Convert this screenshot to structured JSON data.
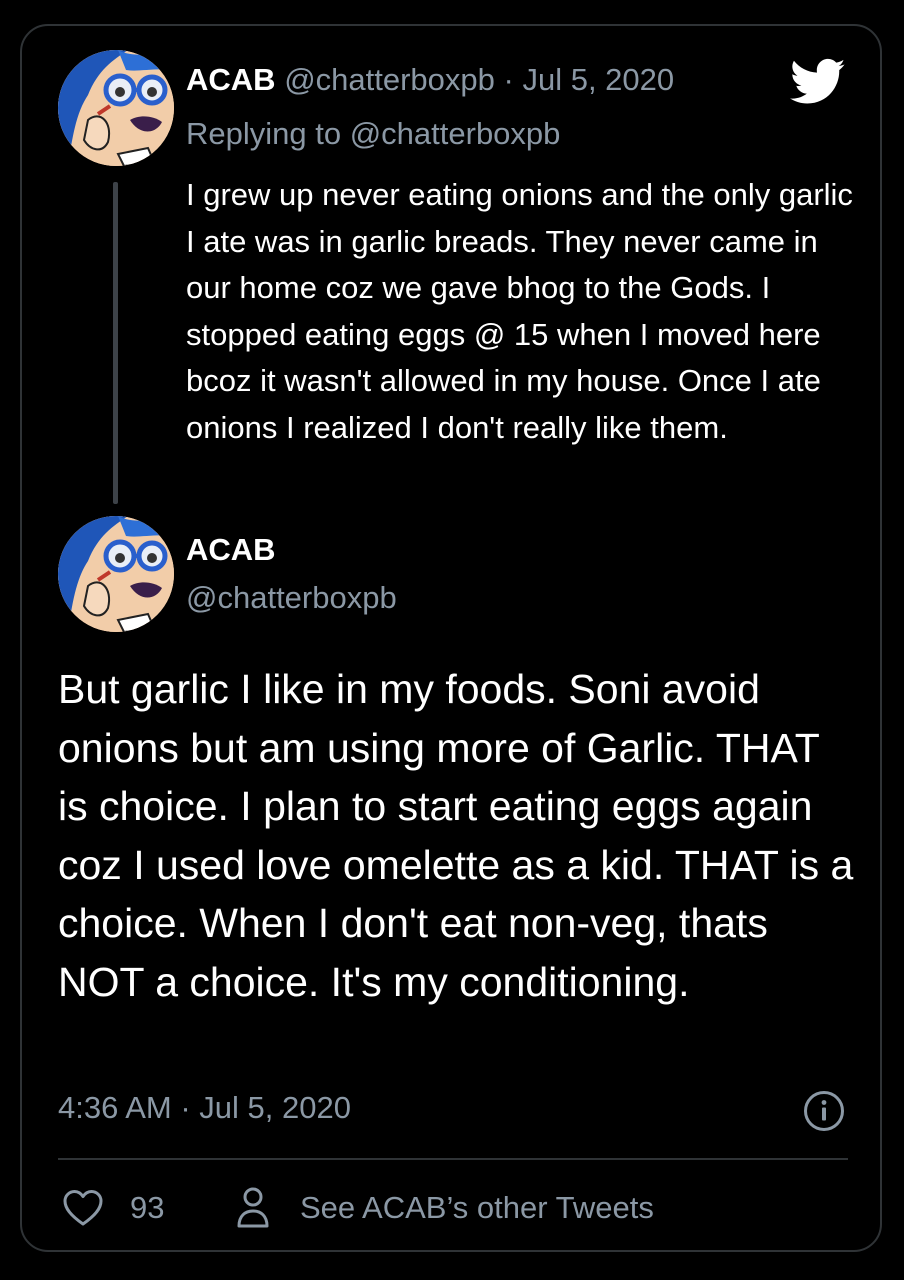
{
  "reply_tweet": {
    "display_name": "ACAB",
    "handle": "@chatterboxpb",
    "separator": "·",
    "date": "Jul 5, 2020",
    "replying_to": "Replying to @chatterboxpb",
    "text": "I grew up never eating onions and the only garlic I ate was in garlic breads. They never came in our home coz we gave bhog to the Gods. I stopped eating eggs @ 15 when I moved here bcoz it wasn't allowed in my house. Once I ate onions I realized I don't really like them."
  },
  "main_tweet": {
    "display_name": "ACAB",
    "handle": "@chatterboxpb",
    "text": "But garlic I like in my foods. Soni avoid onions but am using more of Garlic. THAT is choice. I plan to start eating eggs again coz I used love omelette as a kid. THAT is a choice. When I don't eat non-veg, thats NOT a choice. It's my conditioning.",
    "timestamp": "4:36 AM · Jul 5, 2020",
    "likes": "93",
    "other_tweets_label": "See ACAB’s other Tweets"
  },
  "icons": {
    "brand": "twitter-bird-icon",
    "info": "info-icon",
    "like": "heart-icon",
    "profile": "person-icon"
  },
  "colors": {
    "background": "#000000",
    "border": "#2f3336",
    "text": "#ffffff",
    "muted": "#8b98a5"
  }
}
